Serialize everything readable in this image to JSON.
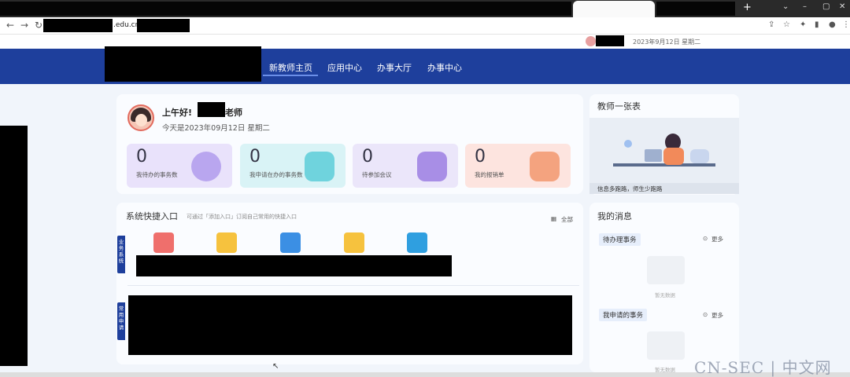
{
  "browser": {
    "url_fragment": ".edu.cn/",
    "new_tab": "+",
    "window_controls": [
      "⌄",
      "–",
      "▢",
      "✕"
    ],
    "nav_icons": [
      "arrow-left-icon",
      "arrow-right-icon",
      "reload-icon"
    ]
  },
  "user_strip": {
    "date": "2023年9月12日  星期二"
  },
  "nav": {
    "items": [
      {
        "label": "新教师主页",
        "active": true
      },
      {
        "label": "应用中心",
        "active": false
      },
      {
        "label": "办事大厅",
        "active": false
      },
      {
        "label": "办事中心",
        "active": false
      }
    ]
  },
  "greeting": {
    "title": "上午好!",
    "suffix": "老师",
    "subtitle": "今天是2023年09月12日 星期二"
  },
  "stats": [
    {
      "value": "0",
      "label": "我待办的事务数",
      "color": "#e9e2fb",
      "icon_color": "#b9a6ef"
    },
    {
      "value": "0",
      "label": "我申请在办的事务数",
      "color": "#d9f3f6",
      "icon_color": "#6fd3dd"
    },
    {
      "value": "0",
      "label": "待参加会议",
      "color": "#ebe6fa",
      "icon_color": "#a88ee6"
    },
    {
      "value": "0",
      "label": "我的报销单",
      "color": "#fde4df",
      "icon_color": "#f4a37f"
    }
  ],
  "quick": {
    "title": "系统快捷入口",
    "hint": "可通过「添加入口」订阅自己常用的快捷入口",
    "all_label": "全部",
    "tag_business": "业务系统",
    "tag_common": "常用申请",
    "icons": [
      {
        "name": "graduation-cap-icon",
        "color": "#ef6f6c"
      },
      {
        "name": "folder-icon",
        "color": "#f6c23e"
      },
      {
        "name": "document-icon",
        "color": "#3b8fe4"
      },
      {
        "name": "card-icon",
        "color": "#f6c23e"
      },
      {
        "name": "edit-icon",
        "color": "#2f9fe0"
      }
    ]
  },
  "right": {
    "table_title": "教师一张表",
    "table_caption": "信息多跑路，师生少跑路",
    "messages_title": "我的消息",
    "pending_tab": "待办理事务",
    "applied_tab": "我申请的事务",
    "more": "更多",
    "empty": "暂无数据"
  },
  "watermark": "CN-SEC | 中文网"
}
